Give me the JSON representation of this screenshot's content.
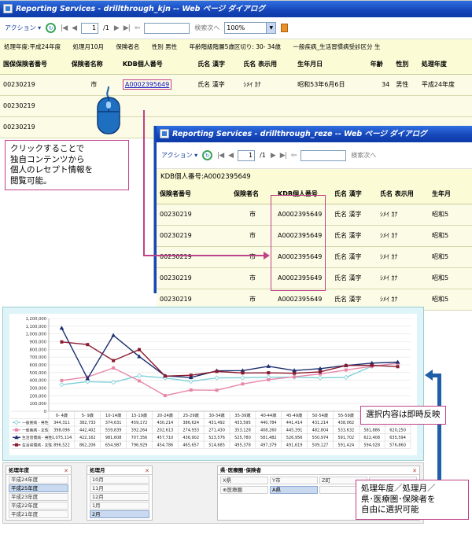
{
  "window1": {
    "title": "Reporting Services - drillthrough_kjn -- Web ページ ダイアログ",
    "toolbar": {
      "action": "アクション ▾",
      "page": "1",
      "page_total": "/1",
      "find": "検索次へ",
      "zoom": "100%"
    },
    "params": [
      "処理年度:平成24年度",
      "処理月10月",
      "保険者名",
      "性別 男性",
      "年齢階級階層5歳区切り: 30- 34歳",
      "一般疾病_生活習慣病受診区分 生"
    ],
    "headers": [
      "国保保険者番号",
      "保険者名称",
      "KDB個人番号",
      "氏名 漢字",
      "氏名 表示用",
      "生年月日",
      "年齢",
      "性別",
      "処理年度"
    ],
    "row": [
      "00230219",
      "市",
      "A0002395649",
      "氏名 漢字",
      "ｼﾒｲ ｶﾅ",
      "昭和53年6月6日",
      "34",
      "男性",
      "平成24年度"
    ],
    "more_rows": [
      "00230219",
      "00230219",
      "00230219"
    ]
  },
  "window2": {
    "title": "Reporting Services - drillthrough_reze -- Web ページ ダイアログ",
    "toolbar": {
      "action": "アクション ▾",
      "page": "1",
      "page_total": "/1",
      "find": "検索次へ"
    },
    "kdb_label": "KDB個人番号:A0002395649",
    "headers": [
      "保険者番号",
      "保険者名",
      "KDB個人番号",
      "氏名 漢字",
      "氏名 表示用",
      "生年月"
    ],
    "rows": [
      [
        "00230219",
        "市",
        "A0002395649",
        "氏名 漢字",
        "ｼﾒｲ ｶﾅ",
        "昭和5"
      ],
      [
        "00230219",
        "市",
        "A0002395649",
        "氏名 漢字",
        "ｼﾒｲ ｶﾅ",
        "昭和5"
      ],
      [
        "00230219",
        "市",
        "A0002395649",
        "氏名 漢字",
        "ｼﾒｲ ｶﾅ",
        "昭和5"
      ],
      [
        "00230219",
        "市",
        "A0002395649",
        "氏名 漢字",
        "ｼﾒｲ ｶﾅ",
        "昭和5"
      ],
      [
        "00230219",
        "市",
        "A0002395649",
        "氏名 漢字",
        "ｼﾒｲ ｶﾅ",
        "昭和5"
      ]
    ]
  },
  "callouts": {
    "click": [
      "クリックすることで",
      "独自コンテンツから",
      "個人のレセプト情報を",
      "閲覧可能。"
    ],
    "reflect": "選択内容は即時反映",
    "select": [
      "処理年度／処理月／",
      "県･医療圏･保険者を",
      "自由に選択可能"
    ]
  },
  "colors": {
    "callout_border": "#c0428a",
    "arrow": "#1f5fa8",
    "titlebar": "#1545b8"
  },
  "chart_data": {
    "type": "line",
    "categories": [
      "0- 4歳",
      "5- 9歳",
      "10-14歳",
      "15-19歳",
      "20-24歳",
      "25-29歳",
      "30-34歳",
      "35-39歳",
      "40-44歳",
      "45-49歳",
      "50-54歳",
      "55-59歳",
      "60-64歳",
      "65-69歳"
    ],
    "ylim": [
      0,
      1200000
    ],
    "yticks": [
      "0",
      "100,000",
      "200,000",
      "300,000",
      "400,000",
      "500,000",
      "600,000",
      "700,000",
      "800,000",
      "900,000",
      "1,000,000",
      "1,100,000",
      "1,200,000"
    ],
    "grid": true,
    "series": [
      {
        "name": "一般疾病 - 男性",
        "color": "#7fd0d8",
        "marker": "diamond",
        "values": [
          344311,
          382733,
          374631,
          459172,
          430214,
          386624,
          431492,
          433595,
          440784,
          441414,
          431214,
          438062,
          581886,
          620250
        ]
      },
      {
        "name": "一般疾病 - 女性",
        "color": "#e888a8",
        "marker": "square",
        "values": [
          398096,
          442402,
          559839,
          392264,
          202613,
          274933,
          271430,
          353128,
          408260,
          445391,
          482804,
          533632,
          581886,
          620250
        ]
      },
      {
        "name": "生活習慣病 - 男性",
        "color": "#1a2e6e",
        "marker": "triangle",
        "values": [
          1075114,
          422162,
          981608,
          707356,
          457710,
          436902,
          523576,
          525780,
          581482,
          526956,
          550974,
          591702,
          622408,
          635594
        ]
      },
      {
        "name": "生活習慣病 - 女性",
        "color": "#8a1a30",
        "marker": "square",
        "values": [
          896522,
          862206,
          654987,
          796929,
          454786,
          465657,
          514685,
          495378,
          497379,
          491619,
          509127,
          591424,
          594028,
          576860
        ]
      }
    ]
  },
  "slicers": {
    "year": {
      "header": "処理年度",
      "items": [
        "平成24年度",
        "平成25年度",
        "平成23年度",
        "平成22年度",
        "平成21年度",
        "平成20年度"
      ],
      "selected": 1
    },
    "month": {
      "header": "処理月",
      "items": [
        "10月",
        "11月",
        "12月",
        "1月",
        "2月",
        "3月"
      ],
      "selected": 4
    },
    "area": {
      "header": "県･医療圏･保険者",
      "items": [
        "X県",
        "Y市",
        "Z町",
        "",
        "⊕医療圏",
        "A県",
        "",
        ""
      ],
      "selected": 5
    }
  }
}
